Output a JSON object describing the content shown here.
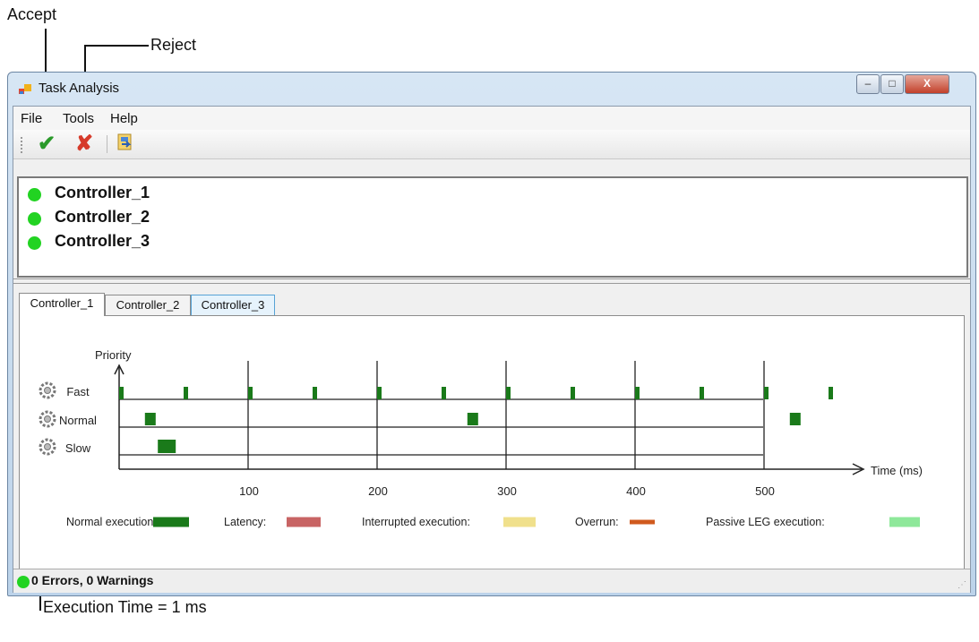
{
  "callouts": {
    "accept": "Accept",
    "reject": "Reject",
    "execution_time": "Execution Time = 1 ms"
  },
  "window": {
    "title": "Task Analysis",
    "buttons": {
      "minimize": "–",
      "maximize": "□",
      "close": "X"
    }
  },
  "menu": {
    "file": "File",
    "tools": "Tools",
    "help": "Help"
  },
  "toolbar": {
    "accept_icon": "check-icon",
    "reject_icon": "x-icon",
    "export_icon": "export-icon"
  },
  "controllers": [
    "Controller_1",
    "Controller_2",
    "Controller_3"
  ],
  "tabs": [
    "Controller_1",
    "Controller_2",
    "Controller_3"
  ],
  "status": {
    "text": "0 Errors,  0 Warnings"
  },
  "colors": {
    "normal_execution": "#1a7a1a",
    "latency": "#c86464",
    "interrupted_execution": "#f0e08c",
    "overrun": "#d05a1e",
    "passive_leg_execution": "#8ee89a",
    "status_ok": "#22d322"
  },
  "chart_data": {
    "type": "timeline",
    "ylabel": "Priority",
    "xlabel": "Time (ms)",
    "x_ticks": [
      100,
      200,
      300,
      400,
      500
    ],
    "xlim": [
      0,
      575
    ],
    "rows": [
      "Fast",
      "Normal",
      "Slow"
    ],
    "executions": {
      "Fast": [
        0,
        50,
        100,
        150,
        200,
        250,
        300,
        350,
        400,
        450,
        500,
        550
      ],
      "Normal": [
        20,
        270,
        520
      ],
      "Slow": [
        30
      ]
    },
    "legend": [
      {
        "label": "Normal execution:",
        "color": "#1a7a1a"
      },
      {
        "label": "Latency:",
        "color": "#c86464"
      },
      {
        "label": "Interrupted execution:",
        "color": "#f0e08c"
      },
      {
        "label": "Overrun:",
        "color": "#d05a1e"
      },
      {
        "label": "Passive LEG execution:",
        "color": "#8ee89a"
      }
    ]
  }
}
